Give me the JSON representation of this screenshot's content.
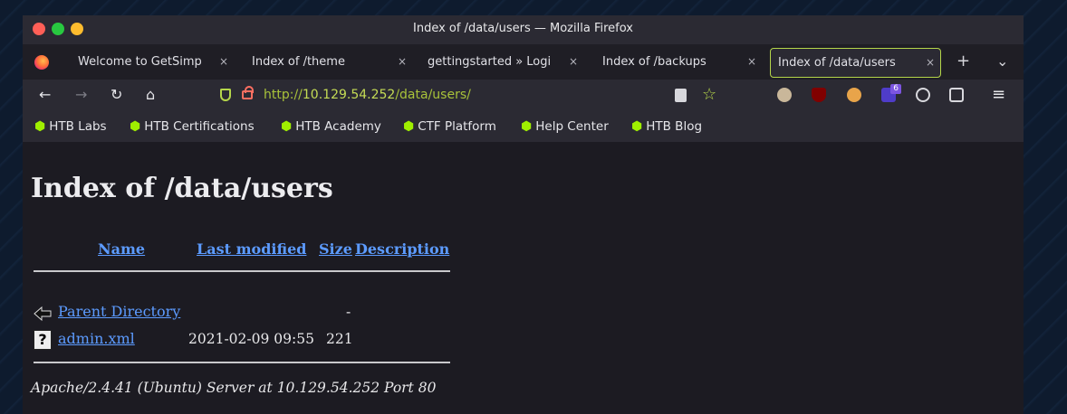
{
  "window": {
    "title": "Index of /data/users — Mozilla Firefox"
  },
  "tabs": [
    {
      "label": "Welcome to GetSimp",
      "active": false
    },
    {
      "label": "Index of /theme",
      "active": false
    },
    {
      "label": "gettingstarted » Logi",
      "active": false
    },
    {
      "label": "Index of /backups",
      "active": false
    },
    {
      "label": "Index of /data/users",
      "active": true
    }
  ],
  "tab_close": "×",
  "new_tab": "+",
  "tab_list": "⌄",
  "nav": {
    "back": "←",
    "forward": "→",
    "reload": "↻",
    "home": "⌂",
    "url_prefix": "http://",
    "url_host": "10.129.54.252",
    "url_path": "/data/users/",
    "star": "☆",
    "menu": "≡",
    "extension_badge": "6"
  },
  "bookmarks": [
    "HTB Labs",
    "HTB Certifications",
    "HTB Academy",
    "CTF Platform",
    "Help Center",
    "HTB Blog"
  ],
  "page": {
    "heading": "Index of /data/users",
    "columns": [
      "Name",
      "Last modified",
      "Size",
      "Description"
    ],
    "rows": [
      {
        "name": "Parent Directory",
        "modified": "",
        "size": "-",
        "description": ""
      },
      {
        "name": "admin.xml",
        "modified": "2021-02-09 09:55",
        "size": "221",
        "description": ""
      }
    ],
    "footer": "Apache/2.4.41 (Ubuntu) Server at 10.129.54.252 Port 80"
  }
}
